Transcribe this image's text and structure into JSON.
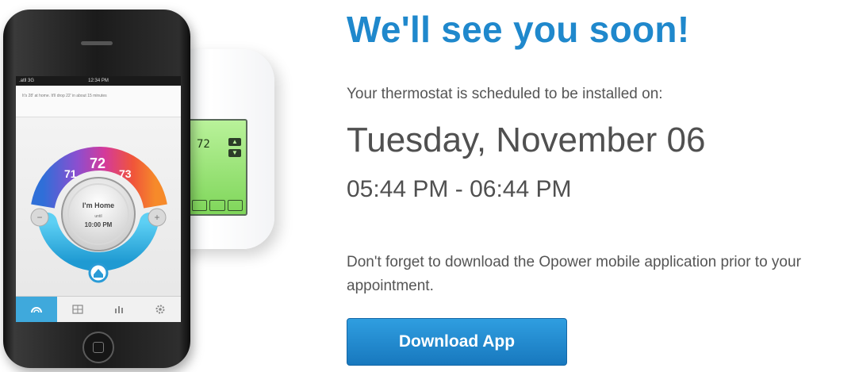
{
  "page": {
    "headline": "We'll see you soon!",
    "schedule_label": "Your thermostat is scheduled to be installed on:",
    "date": "Tuesday, November 06",
    "time_range": "05:44 PM - 06:44 PM",
    "reminder": "Don't forget to download the Opower mobile application prior to your appointment.",
    "download_button": "Download App"
  },
  "phone_illustration": {
    "status_time": "12:34 PM",
    "status_carrier": ".atll 3G",
    "message": "It's 28' at home. It'll drop 22' in about 15 minutes",
    "dial_temps": [
      "71",
      "72",
      "73"
    ],
    "mode_title": "I'm Home",
    "mode_until_label": "until",
    "mode_until_time": "10:00 PM",
    "minus_label": "−",
    "plus_label": "+",
    "tabs": [
      "dial-icon",
      "calendar-icon",
      "chart-icon",
      "settings-icon"
    ]
  },
  "wall_thermostat": {
    "display_temp": "72"
  },
  "colors": {
    "headline": "#1f88cc",
    "button": "#1f88cc",
    "body_text": "#555555"
  }
}
